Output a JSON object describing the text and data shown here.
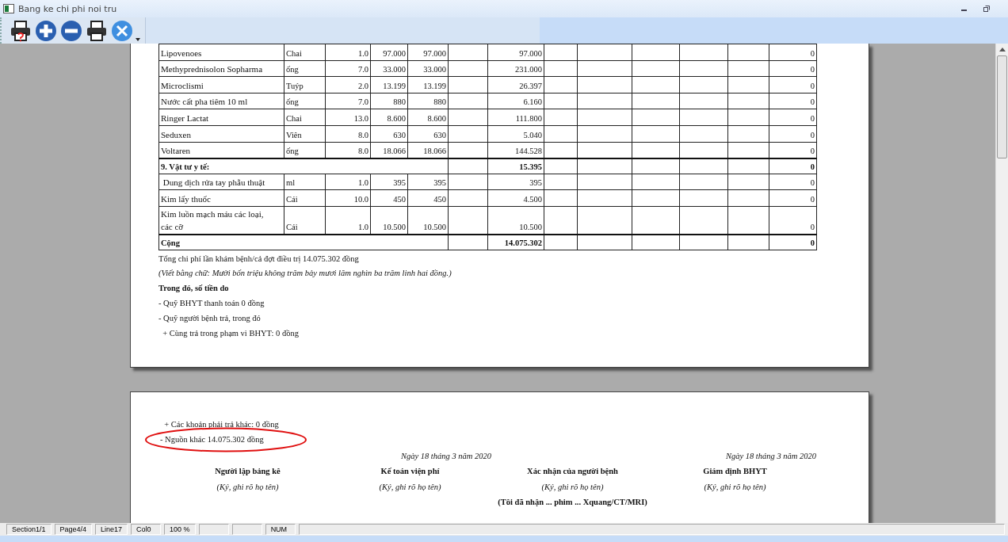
{
  "window": {
    "title": "Bang ke chi phi noi tru"
  },
  "table": {
    "rows": [
      {
        "kind": "item",
        "name": "Lipovenoes",
        "unit": "Chai",
        "quantity": "1.0",
        "unit_price": "97.000",
        "price_2": "97.000",
        "amount": "97.000",
        "column_13": "0"
      },
      {
        "kind": "item",
        "name": "Methyprednisolon Sopharma",
        "unit": "ống",
        "quantity": "7.0",
        "unit_price": "33.000",
        "price_2": "33.000",
        "amount": "231.000",
        "column_13": "0"
      },
      {
        "kind": "item",
        "name": "Microclismi",
        "unit": "Tuýp",
        "quantity": "2.0",
        "unit_price": "13.199",
        "price_2": "13.199",
        "amount": "26.397",
        "column_13": "0"
      },
      {
        "kind": "item",
        "name": "Nước cất pha tiêm 10 ml",
        "unit": "ống",
        "quantity": "7.0",
        "unit_price": "880",
        "price_2": "880",
        "amount": "6.160",
        "column_13": "0"
      },
      {
        "kind": "item",
        "name": "Ringer Lactat",
        "unit": "Chai",
        "quantity": "13.0",
        "unit_price": "8.600",
        "price_2": "8.600",
        "amount": "111.800",
        "column_13": "0"
      },
      {
        "kind": "item",
        "name": "Seduxen",
        "unit": "Viên",
        "quantity": "8.0",
        "unit_price": "630",
        "price_2": "630",
        "amount": "5.040",
        "column_13": "0"
      },
      {
        "kind": "item",
        "name": "Voltaren",
        "unit": "ống",
        "quantity": "8.0",
        "unit_price": "18.066",
        "price_2": "18.066",
        "amount": "144.528",
        "column_13": "0"
      },
      {
        "kind": "section",
        "name": "9. Vật tư y tế:",
        "amount": "15.395",
        "column_13": "0"
      },
      {
        "kind": "item",
        "name": " Dung dịch rửa tay phẫu thuật",
        "unit": "ml",
        "quantity": "1.0",
        "unit_price": "395",
        "price_2": "395",
        "amount": "395",
        "column_13": "0"
      },
      {
        "kind": "item",
        "name": "Kim lấy thuốc",
        "unit": "Cái",
        "quantity": "10.0",
        "unit_price": "450",
        "price_2": "450",
        "amount": "4.500",
        "column_13": "0"
      },
      {
        "kind": "item",
        "name": "Kim luồn mạch máu các loại, các cỡ",
        "unit": "Cái",
        "quantity": "1.0",
        "unit_price": "10.500",
        "price_2": "10.500",
        "amount": "10.500",
        "column_13": "0"
      },
      {
        "kind": "section",
        "name": "Cộng",
        "amount": "14.075.302",
        "column_13": "0"
      }
    ]
  },
  "page_1_lines": [
    {
      "kind": "plain",
      "text": "Tổng chi phí lần khám bệnh/cả đợt điều trị 14.075.302 đồng"
    },
    {
      "kind": "italic",
      "text": "(Viết bằng chữ: Mười bốn triệu không trăm bảy mươi lăm nghìn ba trăm linh hai đồng.)"
    },
    {
      "kind": "bold",
      "text": "Trong đó, số tiền do"
    },
    {
      "kind": "plain",
      "text": "- Quỹ BHYT thanh toán 0 đồng"
    },
    {
      "kind": "plain",
      "text": "- Quỹ người bệnh trả, trong đó"
    },
    {
      "kind": "plain",
      "text": "  + Cùng trả trong phạm vi BHYT: 0 đồng"
    }
  ],
  "page_2_lines": [
    {
      "text": "  + Các khoản phải trả khác: 0 đồng",
      "circled": false
    },
    {
      "text": "- Nguồn khác 14.075.302 đồng",
      "circled": true
    }
  ],
  "signatures": [
    {
      "title": "Người lập bảng kê",
      "note": "(Ký, ghi rõ họ tên)"
    },
    {
      "date": "Ngày 18 tháng 3 năm 2020",
      "title": "Kế toán viện phí",
      "note": "(Ký, ghi rõ họ tên)"
    },
    {
      "title": "Xác nhận của người bệnh",
      "note": "(Ký, ghi rõ họ tên)",
      "extra": "(Tôi đã nhận ... phim ... Xquang/CT/MRI)"
    },
    {
      "date": "Ngày 18 tháng 3 năm 2020",
      "title": "Giám định BHYT",
      "note": "(Ký, ghi rõ họ tên)"
    }
  ],
  "status_bar": [
    {
      "kind": "text",
      "text": "Section1/1"
    },
    {
      "kind": "text",
      "text": "Page4/4"
    },
    {
      "kind": "text",
      "text": "Line17"
    },
    {
      "kind": "text",
      "text": "Col0"
    },
    {
      "kind": "text",
      "text": "100 %"
    },
    {
      "kind": "blank"
    },
    {
      "kind": "blank"
    },
    {
      "kind": "text",
      "text": "NUM"
    }
  ]
}
